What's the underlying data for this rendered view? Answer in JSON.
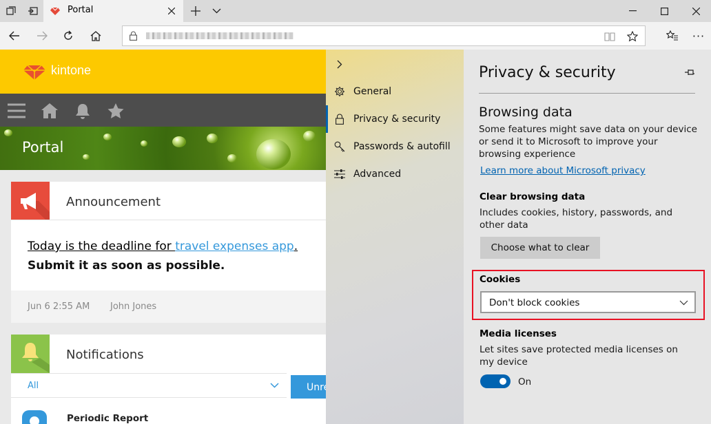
{
  "browser": {
    "tab_title": "Portal",
    "address_url": "",
    "colors": {
      "tabbar": "#dadada",
      "navbar": "#f2f2f2"
    }
  },
  "kintone": {
    "brand": "kintone",
    "banner_title": "Portal",
    "announcement": {
      "title": "Announcement",
      "line1_prefix": "Today is the deadline for ",
      "line1_link": "travel expenses app",
      "line1_suffix": ".",
      "line2": "Submit it as soon as possible.",
      "date": "Jun 6 2:55 AM",
      "author": "John Jones"
    },
    "notifications": {
      "title": "Notifications",
      "filter_value": "All",
      "unread_button": "Unre",
      "item_title": "Periodic Report"
    },
    "colors": {
      "header": "#fdc900",
      "menubar": "#4d4d4d",
      "link": "#3498db",
      "announce": "#e74c3c",
      "notify": "#8bc34a"
    }
  },
  "settings": {
    "menu": [
      {
        "label": "General",
        "icon": "gear-icon"
      },
      {
        "label": "Privacy & security",
        "icon": "lock-icon"
      },
      {
        "label": "Passwords & autofill",
        "icon": "key-icon"
      },
      {
        "label": "Advanced",
        "icon": "sliders-icon"
      }
    ],
    "panel_title": "Privacy & security",
    "browsing_data": {
      "heading": "Browsing data",
      "description": "Some features might save data on your device or send it to Microsoft to improve your browsing experience",
      "link": "Learn more about Microsoft privacy"
    },
    "clear": {
      "heading": "Clear browsing data",
      "description": "Includes cookies, history, passwords, and other data",
      "button": "Choose what to clear"
    },
    "cookies": {
      "heading": "Cookies",
      "value": "Don't block cookies"
    },
    "media": {
      "heading": "Media licenses",
      "description": "Let sites save protected media licenses on my device",
      "toggle_state": "On"
    },
    "colors": {
      "accent": "#0063b1",
      "highlight_border": "#e81123"
    }
  }
}
